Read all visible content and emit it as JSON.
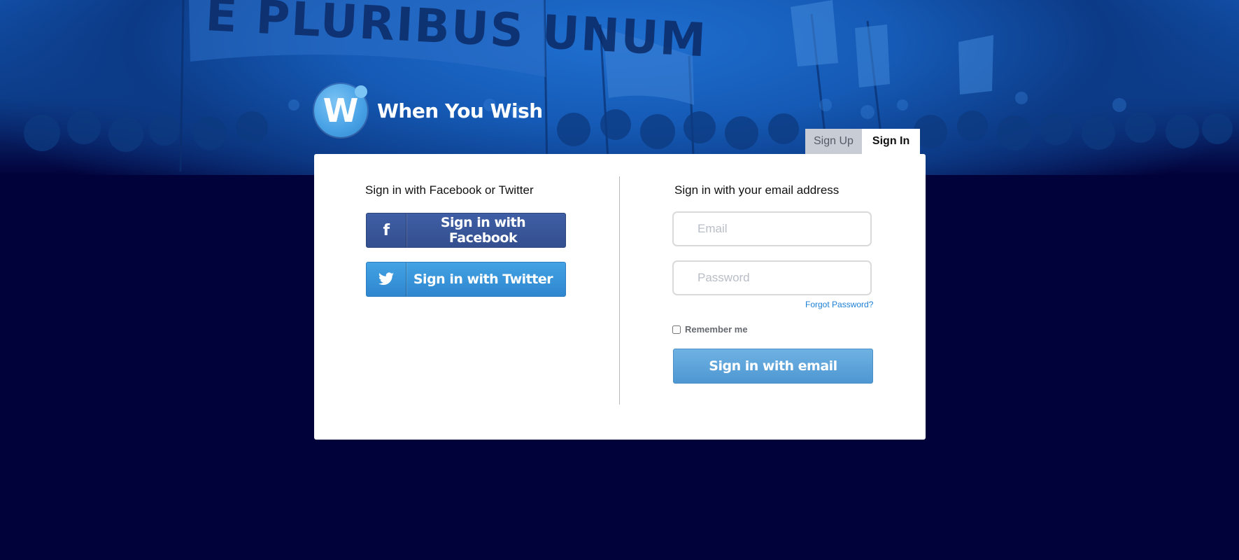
{
  "brand": {
    "logo_letter": "W",
    "name": "When You Wish",
    "banner_text": "E PLURIBUS UNUM"
  },
  "tabs": [
    {
      "label": "Sign Up",
      "active": false
    },
    {
      "label": "Sign In",
      "active": true
    }
  ],
  "social": {
    "title": "Sign in with Facebook or Twitter",
    "facebook": {
      "icon": "facebook-icon",
      "glyph": "f",
      "label": "Sign in with Facebook"
    },
    "twitter": {
      "icon": "twitter-bird-icon",
      "label": "Sign in with Twitter"
    }
  },
  "email_form": {
    "title": "Sign in with your email address",
    "email": {
      "value": "",
      "placeholder": "Email"
    },
    "password": {
      "value": "",
      "placeholder": "Password"
    },
    "forgot_label": "Forgot Password?",
    "remember_label": "Remember me",
    "remember_checked": false,
    "submit_label": "Sign in with email"
  },
  "colors": {
    "page_background": "#02023a",
    "hero_blue": "#1457b3",
    "facebook_blue": "#3b5998",
    "twitter_blue": "#3a9be0",
    "email_button": "#5ea5dc",
    "link_blue": "#1b7fd6"
  }
}
